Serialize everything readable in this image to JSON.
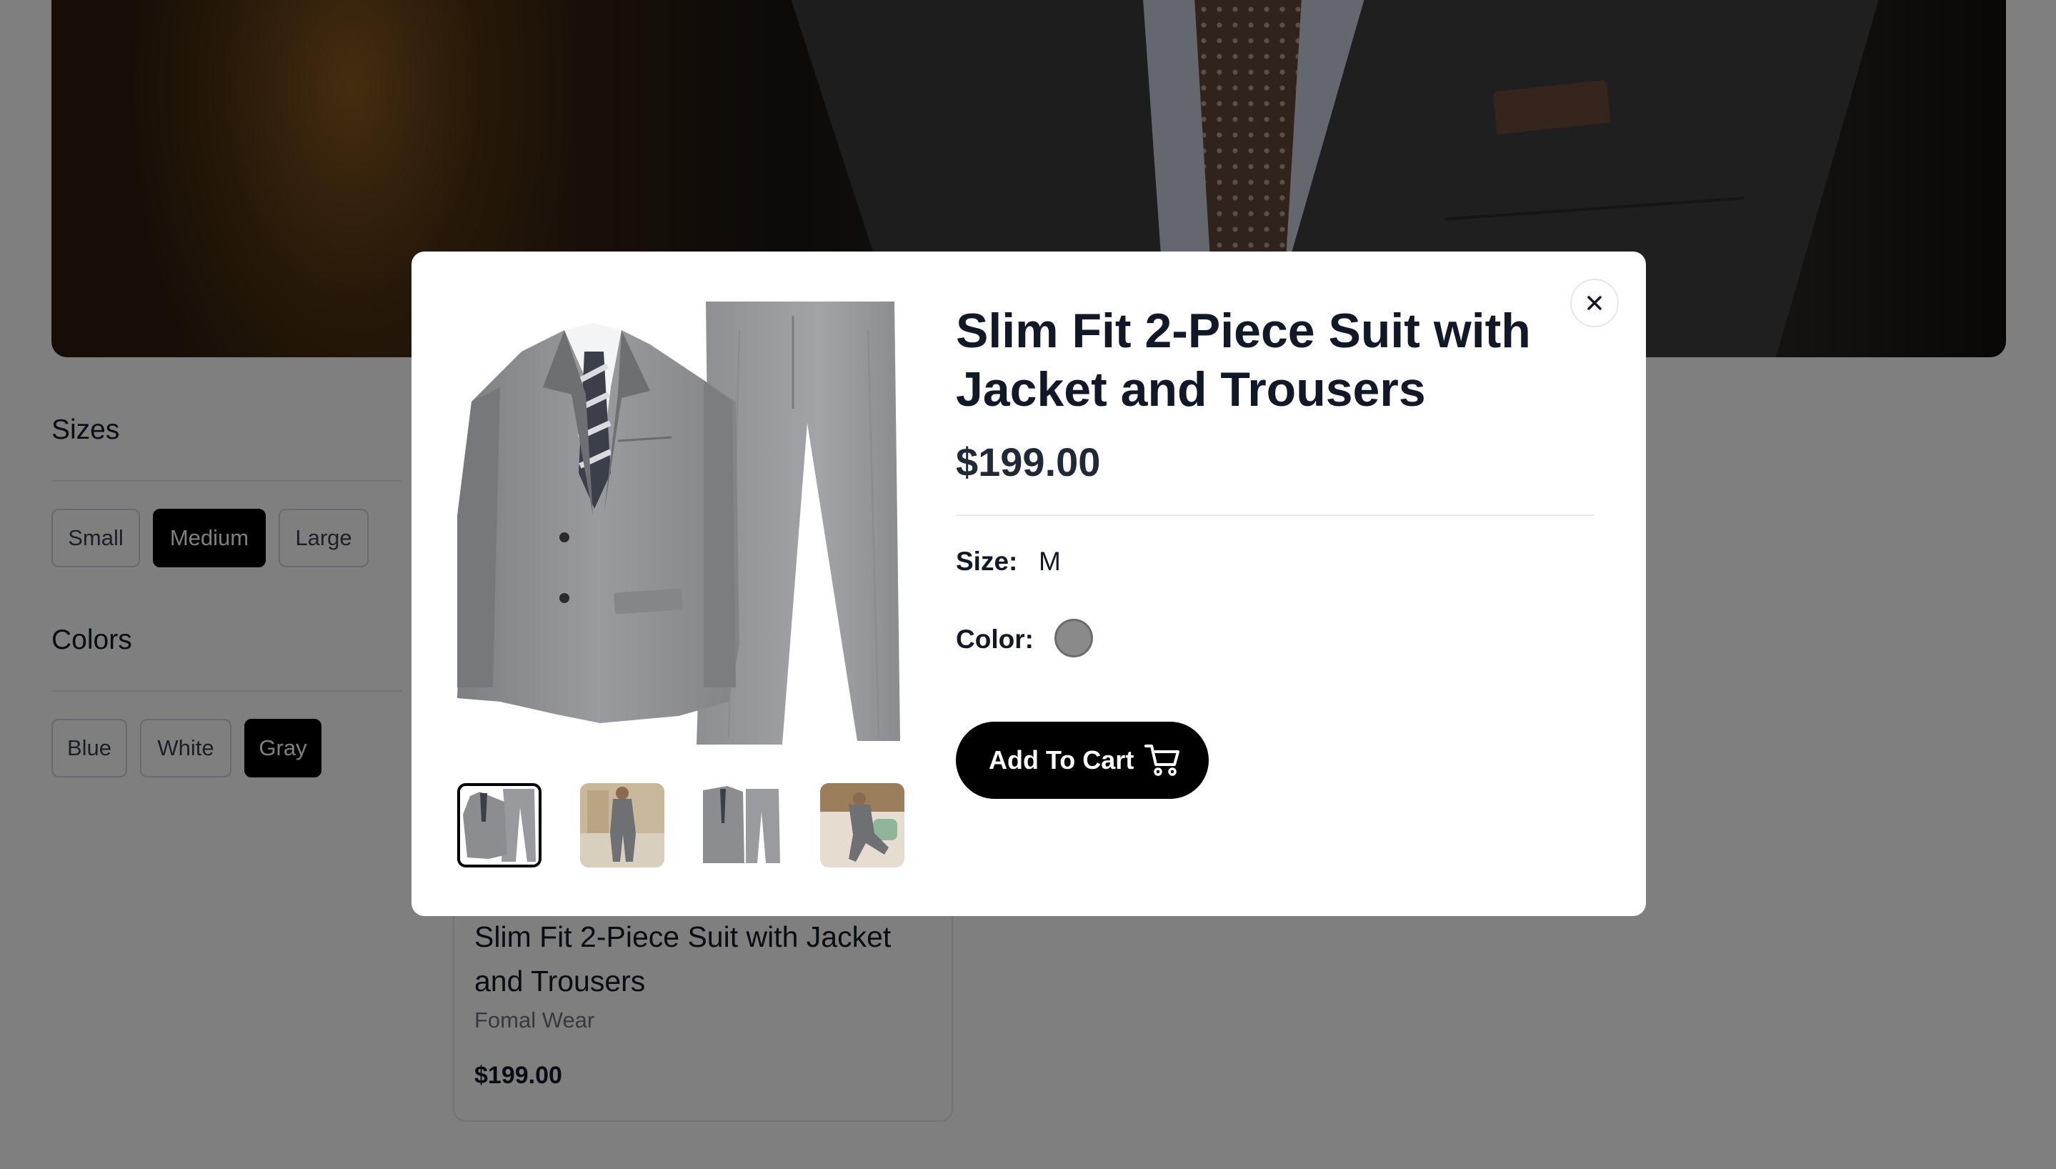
{
  "filters": {
    "sizes_heading": "Sizes",
    "sizes": [
      {
        "label": "Small",
        "selected": false
      },
      {
        "label": "Medium",
        "selected": true
      },
      {
        "label": "Large",
        "selected": false
      }
    ],
    "colors_heading": "Colors",
    "colors": [
      {
        "label": "Blue",
        "selected": false
      },
      {
        "label": "White",
        "selected": false
      },
      {
        "label": "Gray",
        "selected": true
      }
    ]
  },
  "product_card": {
    "title": "Slim Fit 2-Piece Suit with Jacket and Trousers",
    "brand": "Fomal Wear",
    "price": "$199.00"
  },
  "modal": {
    "title": "Slim Fit 2-Piece Suit with Jacket and Trousers",
    "price": "$199.00",
    "size_label": "Size:",
    "size_value": "M",
    "color_label": "Color:",
    "color_swatch": "#8a8a8a",
    "add_to_cart": "Add To Cart",
    "close_icon": "close-icon",
    "thumbnails_count": 4,
    "active_thumbnail": 1
  },
  "colors": {
    "accent": "#000000",
    "overlay": "rgba(0,0,0,0.5)",
    "suit_gray": "#8a8a8a"
  }
}
